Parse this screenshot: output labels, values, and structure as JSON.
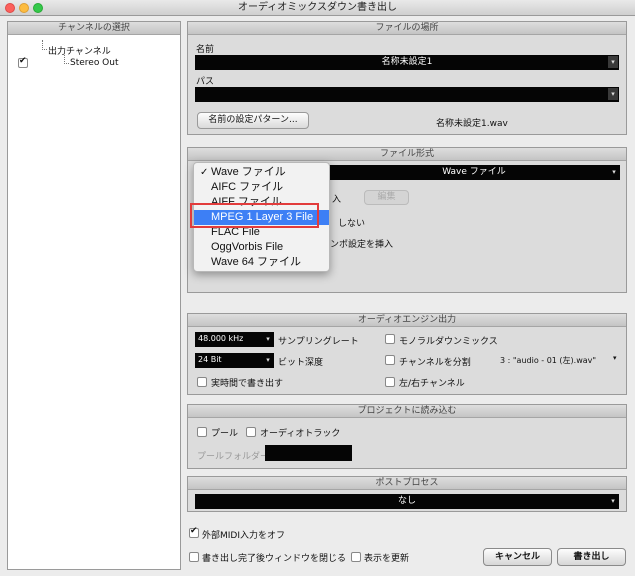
{
  "window": {
    "title": "オーディオミックスダウン書き出し"
  },
  "channels": {
    "header": "チャンネルの選択",
    "parent": "出力チャンネル",
    "child": "Stereo Out",
    "child_checked": true
  },
  "file_location": {
    "header": "ファイルの場所",
    "name_label": "名前",
    "name_value": "名称未設定1",
    "path_label": "パス",
    "path_value": "",
    "pattern_button": "名前の設定パターン...",
    "filename_preview": "名称未設定1.wav"
  },
  "file_format": {
    "header": "ファイル形式",
    "selected_format": "Wave ファイル",
    "edit_button": "編集",
    "partial_text_1": "入",
    "partial_text_2": "しない",
    "partial_text_3": "ンポ設定を挿入",
    "popup_items": [
      {
        "label": "Wave ファイル",
        "checked": true,
        "selected": false
      },
      {
        "label": "AIFC ファイル",
        "checked": false,
        "selected": false
      },
      {
        "label": "AIFF ファイル",
        "checked": false,
        "selected": false
      },
      {
        "label": "MPEG 1 Layer 3 File",
        "checked": false,
        "selected": true
      },
      {
        "label": "FLAC File",
        "checked": false,
        "selected": false
      },
      {
        "label": "OggVorbis File",
        "checked": false,
        "selected": false
      },
      {
        "label": "Wave 64 ファイル",
        "checked": false,
        "selected": false
      }
    ]
  },
  "audio_engine": {
    "header": "オーディオエンジン出力",
    "sample_rate_value": "48.000 kHz",
    "sample_rate_label": "サンプリングレート",
    "bit_depth_value": "24 Bit",
    "bit_depth_label": "ビット深度",
    "realtime_label": "実時間で書き出す",
    "mono_label": "モノラルダウンミックス",
    "split_label": "チャンネルを分割",
    "split_info": "3 : \"audio - 01 (左).wav\"",
    "lr_label": "左/右チャンネル"
  },
  "project_import": {
    "header": "プロジェクトに読み込む",
    "pool_label": "プール",
    "audio_track_label": "オーディオトラック",
    "pool_folder_label": "プールフォルダー"
  },
  "post_process": {
    "header": "ポストプロセス",
    "value": "なし"
  },
  "footer": {
    "midi_off_label": "外部MIDI入力をオフ",
    "midi_off_checked": true,
    "close_window_label": "書き出し完了後ウィンドウを閉じる",
    "refresh_display_label": "表示を更新",
    "cancel_button": "キャンセル",
    "export_button": "書き出し"
  },
  "colors": {
    "selection": "#3d7ff5",
    "highlight_box": "#e23b3b"
  }
}
